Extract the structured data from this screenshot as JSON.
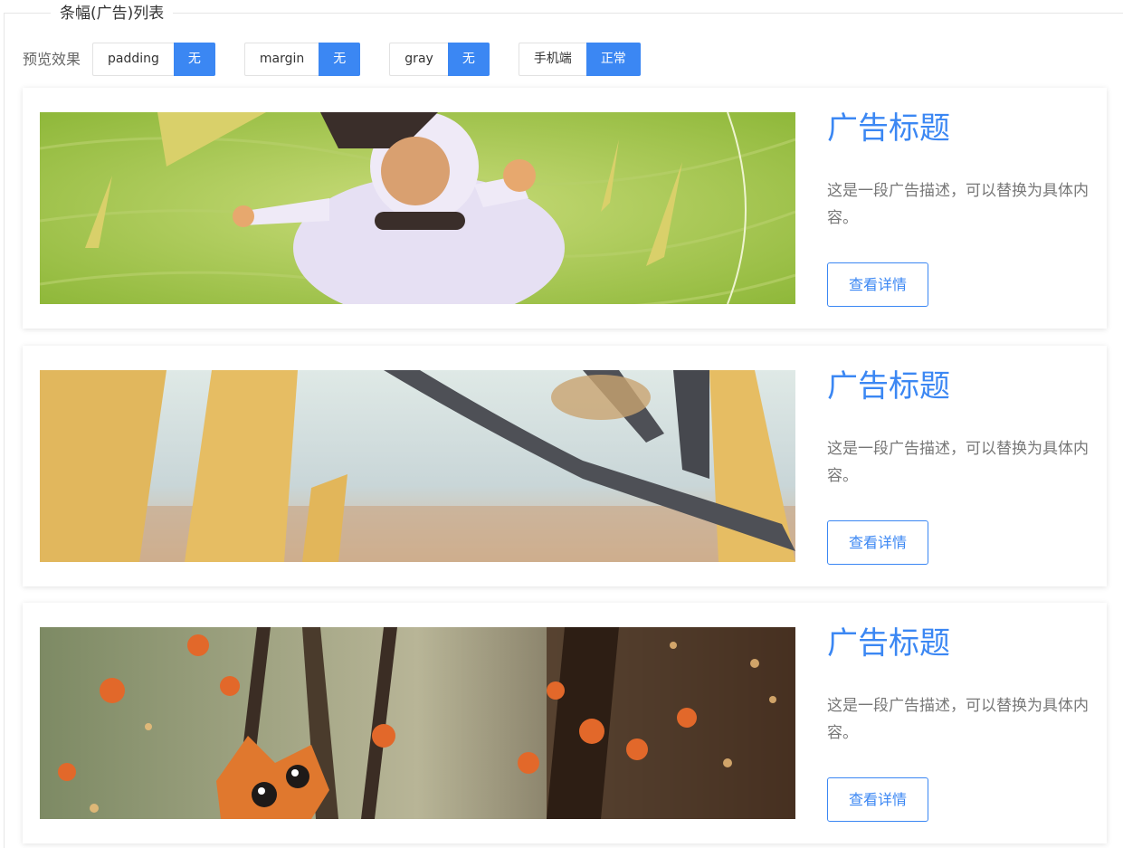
{
  "section": {
    "legend": "条幅(广告)列表"
  },
  "toolbar": {
    "label": "预览效果",
    "options": [
      {
        "name": "padding",
        "value": "无"
      },
      {
        "name": "margin",
        "value": "无"
      },
      {
        "name": "gray",
        "value": "无"
      },
      {
        "name": "手机端",
        "value": "正常"
      }
    ]
  },
  "banners": [
    {
      "title": "广告标题",
      "description": "这是一段广告描述，可以替换为具体内容。",
      "button": "查看详情",
      "image": "child-in-grass-illustration"
    },
    {
      "title": "广告标题",
      "description": "这是一段广告描述，可以替换为具体内容。",
      "button": "查看详情",
      "image": "autumn-forest-trees-illustration"
    },
    {
      "title": "广告标题",
      "description": "这是一段广告描述，可以替换为具体内容。",
      "button": "查看详情",
      "image": "orange-cat-in-forest-illustration"
    }
  ],
  "colors": {
    "accent": "#3b87f3",
    "border": "#e6e6e6",
    "text_muted": "#777777"
  }
}
